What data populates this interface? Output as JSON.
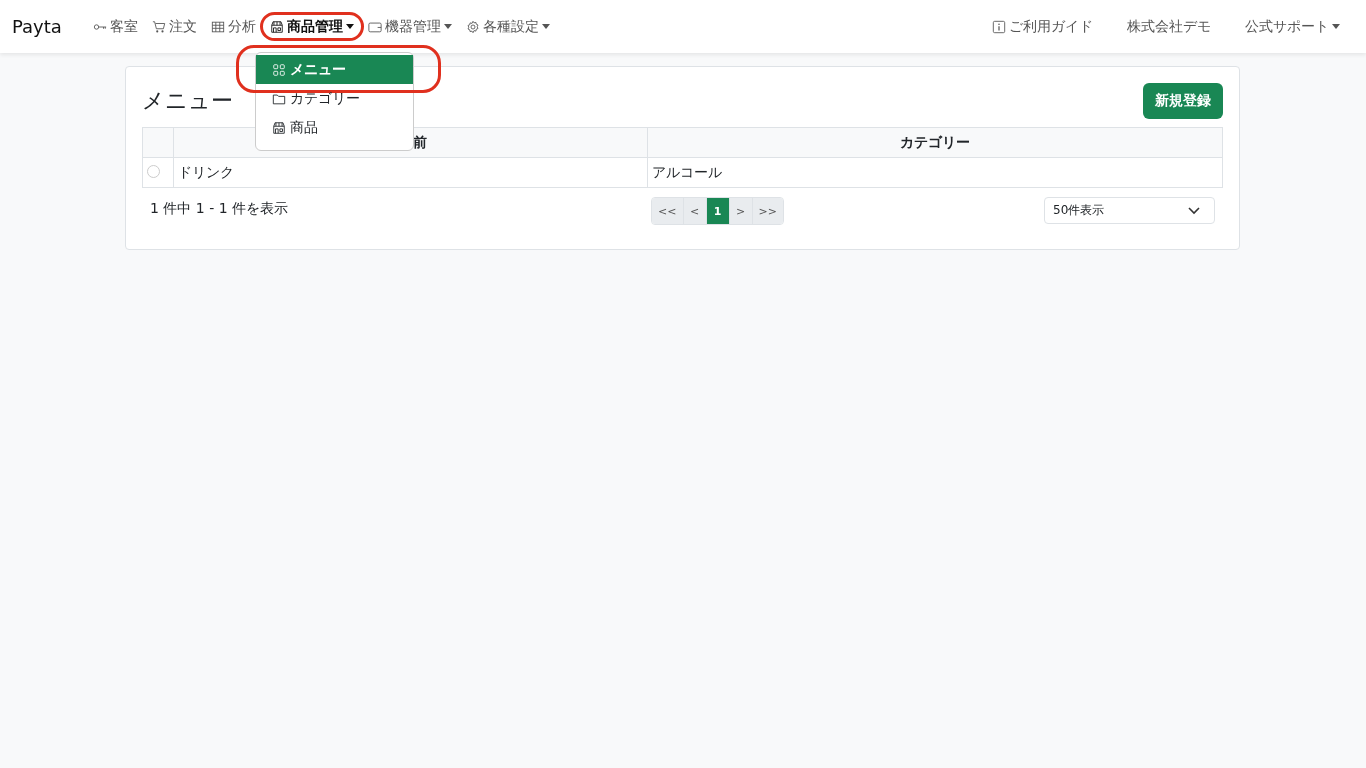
{
  "brand": "Payta",
  "nav": [
    {
      "label": "客室",
      "dropdown": false,
      "selected": false,
      "highlighted": false
    },
    {
      "label": "注文",
      "dropdown": false,
      "selected": false,
      "highlighted": false
    },
    {
      "label": "分析",
      "dropdown": false,
      "selected": false,
      "highlighted": false
    },
    {
      "label": "商品管理",
      "dropdown": true,
      "selected": true,
      "highlighted": true,
      "expanded": true,
      "menu": [
        {
          "label": "メニュー",
          "selected": true,
          "highlighted": true
        },
        {
          "label": "カテゴリー",
          "selected": false,
          "highlighted": false
        },
        {
          "label": "商品",
          "selected": false,
          "highlighted": false
        }
      ]
    },
    {
      "label": "機器管理",
      "dropdown": true,
      "selected": false,
      "highlighted": false
    },
    {
      "label": "各種設定",
      "dropdown": true,
      "selected": false,
      "highlighted": false
    }
  ],
  "nav_right": [
    {
      "label": "ご利用ガイド",
      "dropdown": false
    },
    {
      "label": "株式会社デモ",
      "dropdown": false
    },
    {
      "label": "公式サポート",
      "dropdown": true
    }
  ],
  "page": {
    "title": "メニュー",
    "new_button": "新規登録"
  },
  "table": {
    "columns": [
      {
        "label": "前"
      },
      {
        "label": "カテゴリー"
      }
    ],
    "rows": [
      {
        "selected": false,
        "cells": [
          "ドリンク",
          "アルコール"
        ]
      }
    ]
  },
  "footer": {
    "summary": "1 件中 1 - 1 件を表示",
    "pagination": [
      {
        "label": "<<",
        "selected": false
      },
      {
        "label": "<",
        "selected": false
      },
      {
        "label": "1",
        "selected": true
      },
      {
        "label": ">",
        "selected": false
      },
      {
        "label": ">>",
        "selected": false
      }
    ],
    "page_size": "50件表示"
  }
}
